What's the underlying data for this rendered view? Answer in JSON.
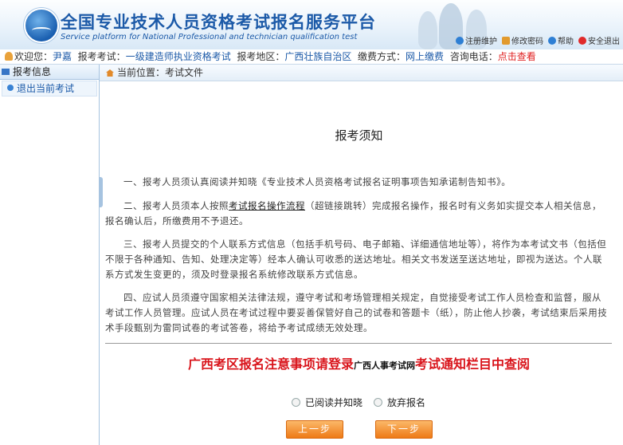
{
  "header": {
    "title_cn": "全国专业技术人员资格考试报名服务平台",
    "title_en": "Service platform for National Professional and technician qualification test",
    "links": [
      {
        "label": "注册维护",
        "icon": "user-settings-icon",
        "color": "#2e7fd4"
      },
      {
        "label": "修改密码",
        "icon": "lock-icon",
        "color": "#e29a2d"
      },
      {
        "label": "帮助",
        "icon": "help-icon",
        "color": "#2e7fd4"
      },
      {
        "label": "安全退出",
        "icon": "power-icon",
        "color": "#e02a2a"
      }
    ]
  },
  "infobar": {
    "welcome_label": "欢迎您：",
    "user_name": "尹嘉",
    "exam_label": "报考考试：",
    "exam_value": "一级建造师执业资格考试",
    "region_label": "报考地区：",
    "region_value": "广西壮族自治区",
    "pay_label": "缴费方式：",
    "pay_value": "网上缴费",
    "phone_label": "咨询电话：",
    "phone_link": "点击查看"
  },
  "sidebar": {
    "heading": "报考信息",
    "items": [
      {
        "label": "退出当前考试"
      }
    ]
  },
  "breadcrumb": {
    "label": "当前位置：",
    "value": "考试文件"
  },
  "main": {
    "title": "报考须知",
    "p1": "一、报考人员须认真阅读并知晓《专业技术人员资格考试报名证明事项告知承诺制告知书》。",
    "p2_before": "二、报考人员须本人按照",
    "p2_link": "考试报名操作流程",
    "p2_after": "（超链接跳转）完成报名操作，报名时有义务如实提交本人相关信息，报名确认后，所缴费用不予退还。",
    "p3": "三、报考人员提交的个人联系方式信息（包括手机号码、电子邮箱、详细通信地址等），将作为本考试文书（包括但不限于各种通知、告知、处理决定等）经本人确认可收悉的送达地址。相关文书发送至送达地址，即视为送达。个人联系方式发生变更的，须及时登录报名系统修改联系方式信息。",
    "p4": "四、应试人员须遵守国家相关法律法规，遵守考试和考场管理相关规定，自觉接受考试工作人员检查和监督，服从考试工作人员管理。应试人员在考试过程中要妥善保管好自己的试卷和答题卡（纸），防止他人抄袭，考试结束后采用技术手段甄别为雷同试卷的考试答卷，将给予考试成绩无效处理。",
    "notice_a": "广西考区报名注意事项请登录",
    "notice_small": "广西人事考试网",
    "notice_b": "考试通知栏目中查阅",
    "radio_read": "已阅读并知晓",
    "radio_abandon": "放弃报名",
    "btn_prev": "上一步",
    "btn_next": "下一步"
  },
  "colors": {
    "brand_blue": "#1c5aa8",
    "notice_red": "#d9141b",
    "button_orange": "#ee7a16"
  }
}
